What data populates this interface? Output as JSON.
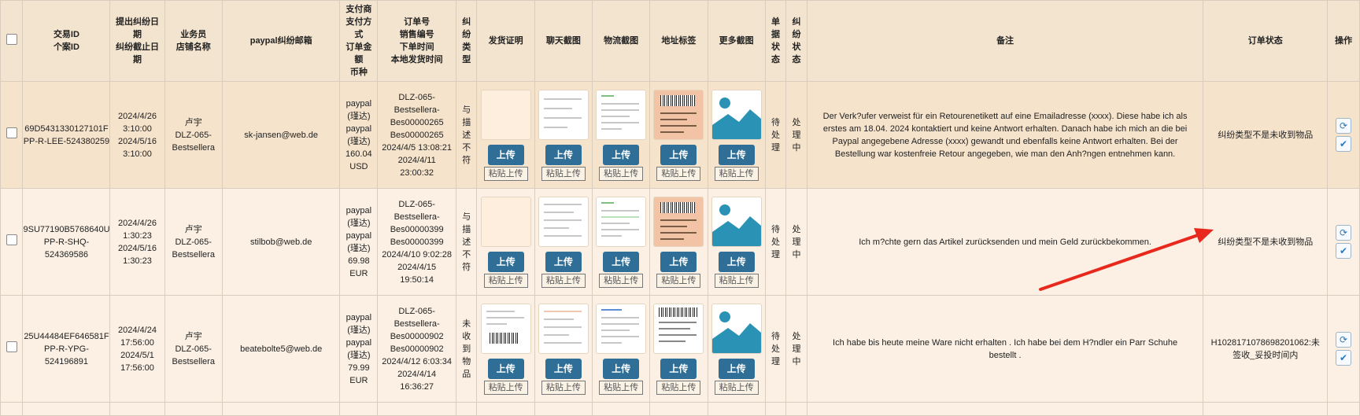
{
  "headers": {
    "trade_id": "交易ID\n个案ID",
    "dispute_date": "提出纠纷日\n期\n纠纷截止日\n期",
    "salesman": "业务员\n店铺名称",
    "paypal_email": "paypal纠纷邮箱",
    "payment": "支付商\n支付方\n式\n订单金\n额\n币种",
    "order_no": "订单号\n销售编号\n下单时间\n本地发货时间",
    "dispute_type": "纠\n纷\n类\n型",
    "ship_proof": "发货证明",
    "chat_shot": "聊天截图",
    "logistics_shot": "物流截图",
    "address_label": "地址标签",
    "more_shots": "更多截图",
    "doc_status": "单\n据\n状\n态",
    "dispute_status": "纠\n纷\n状\n态",
    "remark": "备注",
    "order_status": "订单状态",
    "action": "操作"
  },
  "labels": {
    "upload": "上传",
    "paste": "粘贴上传"
  },
  "rows": [
    {
      "trade_id": "69D5431330127101F\nPP-R-LEE-524380259",
      "dates": "2024/4/26\n3:10:00\n2024/5/16\n3:10:00",
      "salesman": "卢宇\nDLZ-065-\nBestsellera",
      "email": "sk-jansen@web.de",
      "payment": "paypal\n(瑾达)\npaypal\n(瑾达)\n160.04\nUSD",
      "order": "DLZ-065-\nBestsellera-\nBes00000265\nBes00000265\n2024/4/5 13:08:21\n2024/4/11\n23:00:32",
      "dispute_type": "与\n描\n述\n不\n符",
      "doc_status": "待\n处\n理",
      "dispute_status": "处\n理\n中",
      "remark": "Der Verk?ufer verweist für ein Retourenetikett auf eine Emailadresse (xxxx). Diese habe ich als erstes am 18.04. 2024 kontaktiert und keine Antwort erhalten. Danach habe ich mich an die bei Paypal angegebene Adresse (xxxx) gewandt und ebenfalls keine Antwort erhalten. Bei der Bestellung war kostenfreie Retour angegeben, wie man den Anh?ngen entnehmen kann.",
      "order_status": "纠纷类型不是未收到物品"
    },
    {
      "trade_id": "9SU77190B5768640U\nPP-R-SHQ-524369586",
      "dates": "2024/4/26\n1:30:23\n2024/5/16\n1:30:23",
      "salesman": "卢宇\nDLZ-065-\nBestsellera",
      "email": "stilbob@web.de",
      "payment": "paypal\n(瑾达)\npaypal\n(瑾达)\n69.98\nEUR",
      "order": "DLZ-065-\nBestsellera-\nBes00000399\nBes00000399\n2024/4/10 9:02:28\n2024/4/15\n19:50:14",
      "dispute_type": "与\n描\n述\n不\n符",
      "doc_status": "待\n处\n理",
      "dispute_status": "处\n理\n中",
      "remark": "Ich m?chte gern das Artikel zurücksenden und mein Geld zurückbekommen.",
      "order_status": "纠纷类型不是未收到物品"
    },
    {
      "trade_id": "25U44484EF646581F\nPP-R-YPG-524196891",
      "dates": "2024/4/24\n17:56:00\n2024/5/1\n17:56:00",
      "salesman": "卢宇\nDLZ-065-\nBestsellera",
      "email": "beatebolte5@web.de",
      "payment": "paypal\n(瑾达)\npaypal\n(瑾达)\n79.99\nEUR",
      "order": "DLZ-065-\nBestsellera-\nBes00000902\nBes00000902\n2024/4/12 6:03:34\n2024/4/14\n16:36:27",
      "dispute_type": "未\n收\n到\n物\n品",
      "doc_status": "待\n处\n理",
      "dispute_status": "处\n理\n中",
      "remark": "Ich habe bis heute meine Ware nicht erhalten . Ich habe bei dem H?ndler ein Parr Schuhe bestellt .",
      "order_status": "H1028171078698201062:未\n签收_妥投时间内"
    }
  ],
  "colors": {
    "header_bg": "#f3e4cf",
    "row_bg": "#fbf0e3",
    "row_first_bg": "#f5e3cc",
    "upload_btn": "#2f6f97",
    "arrow": "#e8281c"
  },
  "icons": {
    "refresh": "refresh-icon",
    "check": "check-icon"
  }
}
